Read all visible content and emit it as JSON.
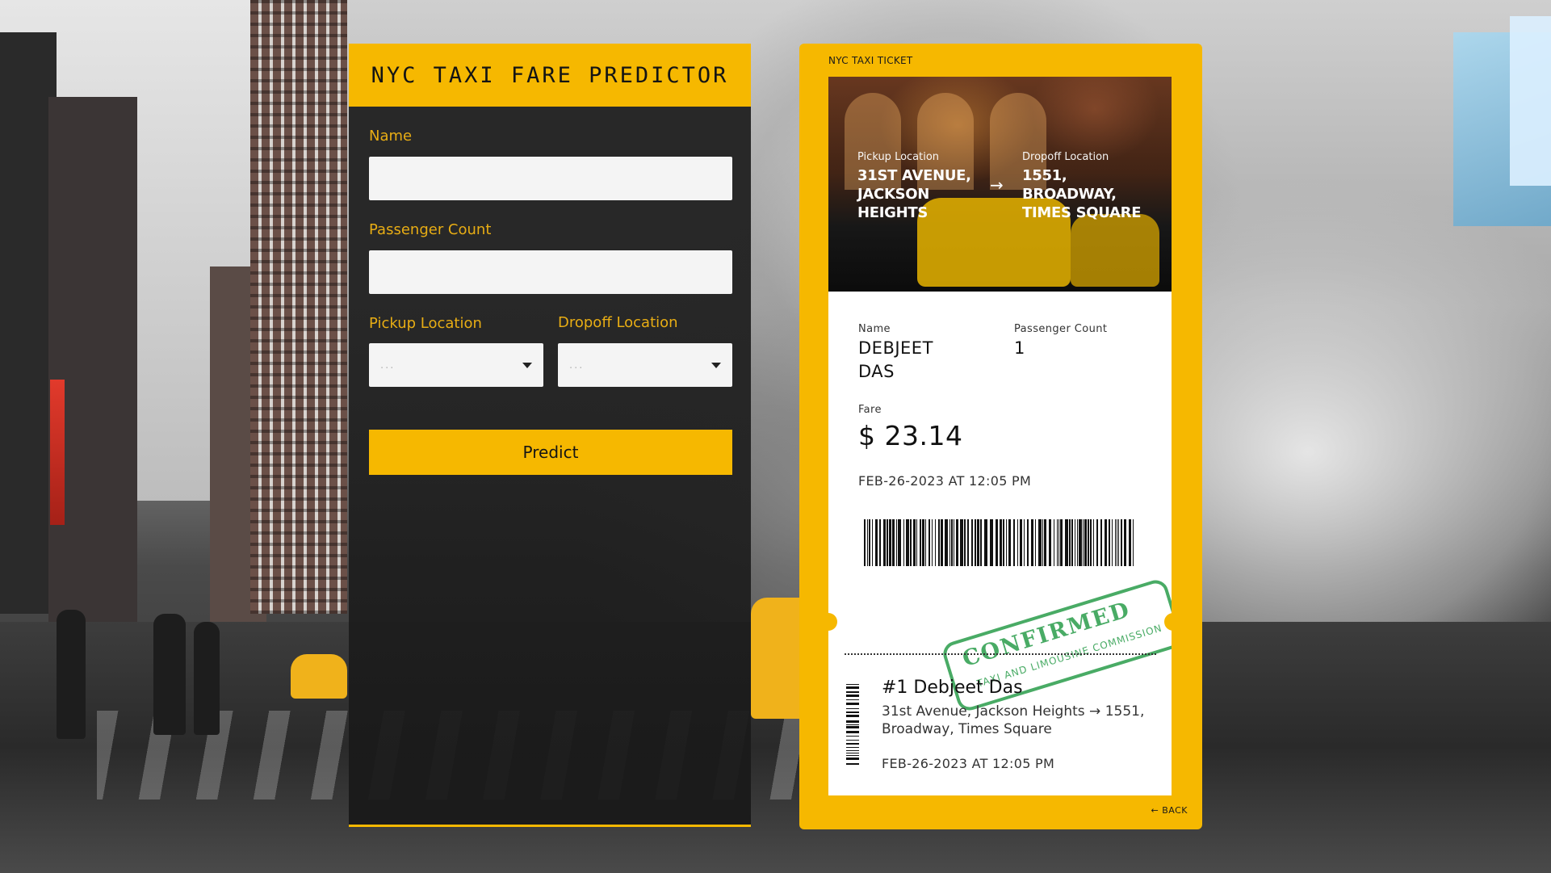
{
  "form": {
    "title": "NYC TAXI FARE PREDICTOR",
    "name_label": "Name",
    "name_value": "",
    "passenger_label": "Passenger Count",
    "passenger_value": "",
    "pickup_label": "Pickup Location",
    "pickup_value": "...",
    "dropoff_label": "Dropoff Location",
    "dropoff_value": "...",
    "predict_label": "Predict"
  },
  "ticket": {
    "brand": "NYC TAXI TICKET",
    "pickup_label": "Pickup Location",
    "pickup_value": "31ST AVENUE, JACKSON HEIGHTS",
    "dropoff_label": "Dropoff Location",
    "dropoff_value": "1551, BROADWAY, TIMES SQUARE",
    "arrow": "→",
    "name_label": "Name",
    "name_value": "DEBJEET DAS",
    "passenger_label": "Passenger Count",
    "passenger_value": "1",
    "fare_label": "Fare",
    "fare_value": "$ 23.14",
    "datetime": "FEB-26-2023 AT 12:05 PM",
    "stamp_main": "CONFIRMED",
    "stamp_sub": "TAXI AND LIMOUSINE COMMISSION",
    "stub_title": "#1 Debjeet Das",
    "stub_route": "31st Avenue, Jackson Heights → 1551, Broadway, Times Square",
    "stub_datetime": "FEB-26-2023 AT 12:05 PM",
    "back_label": "← BACK"
  },
  "colors": {
    "accent": "#f6b800",
    "label": "#e8ad14",
    "stamp": "#2a9d4b"
  }
}
